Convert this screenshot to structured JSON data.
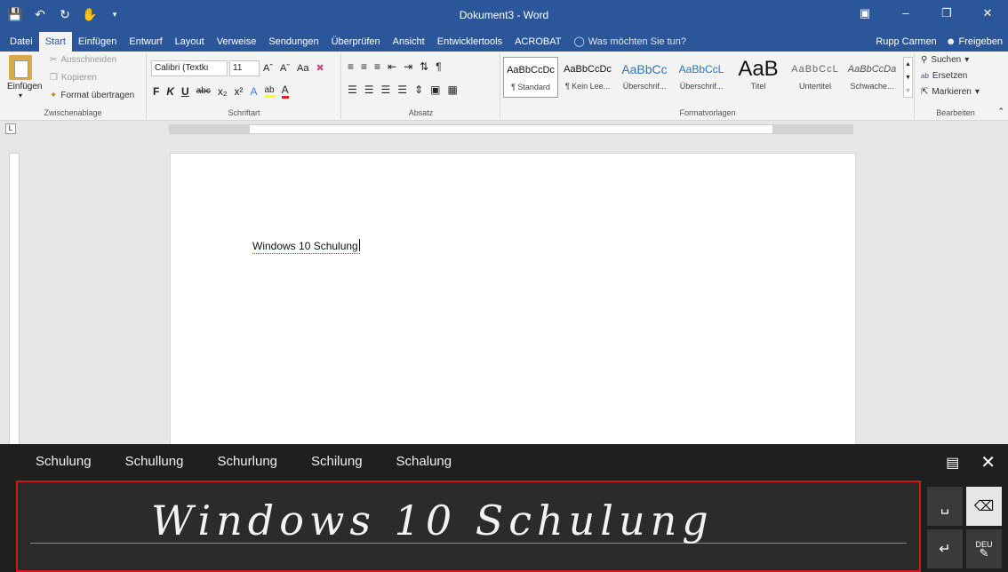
{
  "titlebar": {
    "doc_title": "Dokument3 - Word",
    "qat_icons": [
      "save-icon",
      "undo-icon",
      "redo-icon",
      "touch-mode-icon",
      "customize-icon"
    ],
    "window_buttons": [
      "ribbon-display-icon",
      "minimize-icon",
      "restore-icon",
      "close-icon"
    ]
  },
  "tabs": [
    {
      "label": "Datei",
      "active": false
    },
    {
      "label": "Start",
      "active": true
    },
    {
      "label": "Einfügen",
      "active": false
    },
    {
      "label": "Entwurf",
      "active": false
    },
    {
      "label": "Layout",
      "active": false
    },
    {
      "label": "Verweise",
      "active": false
    },
    {
      "label": "Sendungen",
      "active": false
    },
    {
      "label": "Überprüfen",
      "active": false
    },
    {
      "label": "Ansicht",
      "active": false
    },
    {
      "label": "Entwicklertools",
      "active": false
    },
    {
      "label": "ACROBAT",
      "active": false
    }
  ],
  "tell_me": "Was möchten Sie tun?",
  "user": "Rupp Carmen",
  "share": "Freigeben",
  "clipboard": {
    "paste": "Einfügen",
    "cut": "Ausschneiden",
    "copy": "Kopieren",
    "format_painter": "Format übertragen",
    "group_label": "Zwischenablage"
  },
  "font": {
    "family": "Calibri (Textkı",
    "size": "11",
    "group_label": "Schriftart",
    "bold": "F",
    "italic": "K",
    "underline": "U"
  },
  "paragraph": {
    "group_label": "Absatz"
  },
  "styles": {
    "group_label": "Formatvorlagen",
    "items": [
      {
        "sample": "AaBbCcDc",
        "name": "¶ Standard",
        "selected": true
      },
      {
        "sample": "AaBbCcDc",
        "name": "¶ Kein Lee...",
        "selected": false
      },
      {
        "sample": "AaBbCc",
        "name": "Überschrif...",
        "selected": false
      },
      {
        "sample": "AaBbCcL",
        "name": "Überschrif...",
        "selected": false
      },
      {
        "sample": "AaB",
        "name": "Titel",
        "selected": false
      },
      {
        "sample": "AaBbCcL",
        "name": "Untertitel",
        "selected": false
      },
      {
        "sample": "AaBbCcDa",
        "name": "Schwache...",
        "selected": false
      }
    ]
  },
  "editing": {
    "find": "Suchen",
    "replace": "Ersetzen",
    "select": "Markieren",
    "group_label": "Bearbeiten"
  },
  "ruler_corner": "L",
  "document": {
    "text": "Windows 10 Schulung"
  },
  "handwriting": {
    "suggestions": [
      "Schulung",
      "Schullung",
      "Schurlung",
      "Schilung",
      "Schalung"
    ],
    "ink_text": "Windows 10 Schulung",
    "lang_key": "DEU"
  }
}
